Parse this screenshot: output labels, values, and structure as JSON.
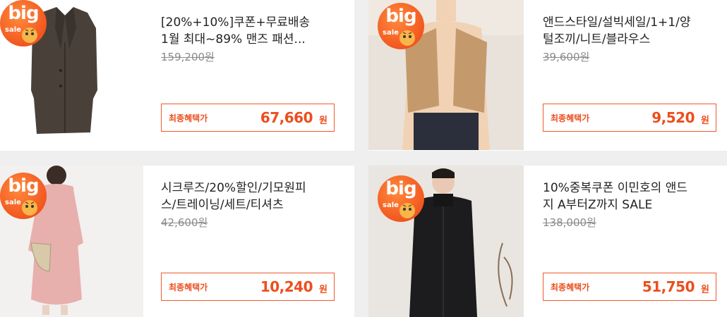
{
  "badge": {
    "big": "big",
    "sale": "sale"
  },
  "products": [
    {
      "title_line1": "[20%+10%]쿠폰+무료배송",
      "title_line2": "1월 최대~89% 맨즈 패션...",
      "original_price": "159,200원",
      "benefit_label": "최종혜택가",
      "final_price": "67,660",
      "currency": "원"
    },
    {
      "title_line1": "앤드스타일/설빅세일/1+1/양",
      "title_line2": "털조끼/니트/블라우스",
      "original_price": "39,600원",
      "benefit_label": "최종혜택가",
      "final_price": "9,520",
      "currency": "원"
    },
    {
      "title_line1": "시크루즈/20%할인/기모원피",
      "title_line2": "스/트레이닝/세트/티셔츠",
      "original_price": "42,600원",
      "benefit_label": "최종혜택가",
      "final_price": "10,240",
      "currency": "원"
    },
    {
      "title_line1": "10%중복쿠폰 이민호의 앤드",
      "title_line2": "지 A부터Z까지 SALE",
      "original_price": "138,000원",
      "benefit_label": "최종혜택가",
      "final_price": "51,750",
      "currency": "원"
    }
  ],
  "colors": {
    "accent": "#ec4e1d",
    "badge": "#f2571f",
    "background": "#efefef"
  }
}
